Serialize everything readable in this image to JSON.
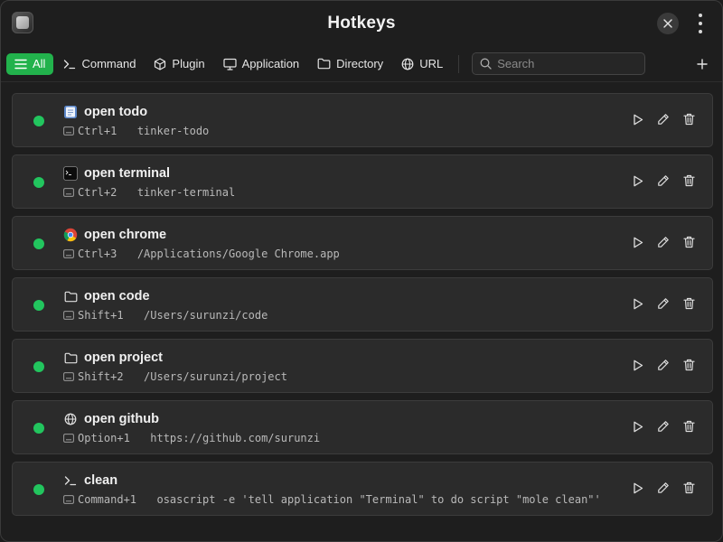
{
  "window": {
    "title": "Hotkeys"
  },
  "tabs": [
    {
      "label": "All",
      "icon": "menu-icon",
      "active": true
    },
    {
      "label": "Command",
      "icon": "terminal-prompt-icon",
      "active": false
    },
    {
      "label": "Plugin",
      "icon": "cube-icon",
      "active": false
    },
    {
      "label": "Application",
      "icon": "monitor-icon",
      "active": false
    },
    {
      "label": "Directory",
      "icon": "folder-icon",
      "active": false
    },
    {
      "label": "URL",
      "icon": "globe-icon",
      "active": false
    }
  ],
  "search": {
    "placeholder": "Search",
    "value": ""
  },
  "colors": {
    "accent": "#22b24c",
    "status_on": "#22c55e"
  },
  "hotkeys": [
    {
      "name": "open todo",
      "icon": "todo-app-icon",
      "shortcut": "Ctrl+1",
      "target": "tinker-todo",
      "enabled": true
    },
    {
      "name": "open terminal",
      "icon": "terminal-app-icon",
      "shortcut": "Ctrl+2",
      "target": "tinker-terminal",
      "enabled": true
    },
    {
      "name": "open chrome",
      "icon": "chrome-icon",
      "shortcut": "Ctrl+3",
      "target": "/Applications/Google Chrome.app",
      "enabled": true
    },
    {
      "name": "open code",
      "icon": "folder-icon",
      "shortcut": "Shift+1",
      "target": "/Users/surunzi/code",
      "enabled": true
    },
    {
      "name": "open project",
      "icon": "folder-icon",
      "shortcut": "Shift+2",
      "target": "/Users/surunzi/project",
      "enabled": true
    },
    {
      "name": "open github",
      "icon": "globe-icon",
      "shortcut": "Option+1",
      "target": "https://github.com/surunzi",
      "enabled": true
    },
    {
      "name": "clean",
      "icon": "terminal-prompt-icon",
      "shortcut": "Command+1",
      "target": "osascript -e 'tell application \"Terminal\" to do script \"mole clean\"'",
      "enabled": true
    }
  ]
}
